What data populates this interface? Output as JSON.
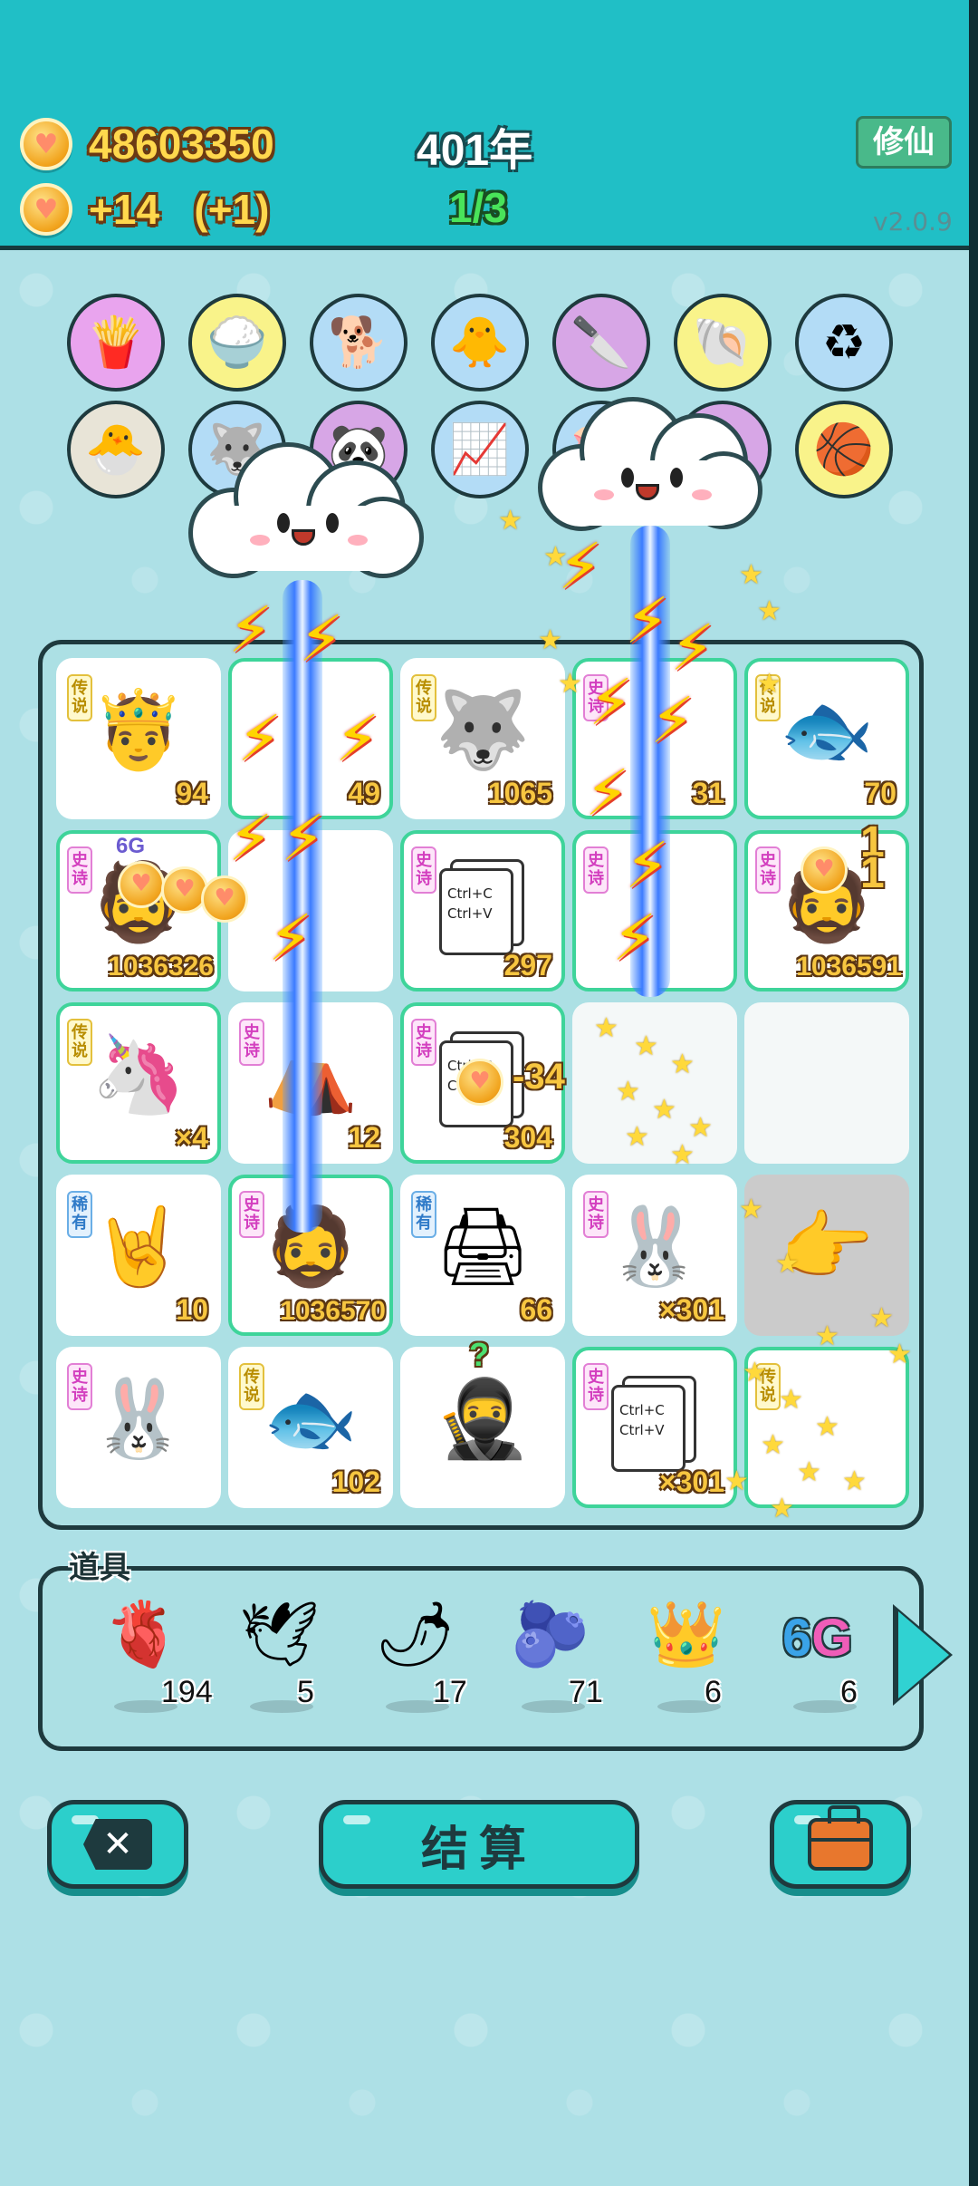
{
  "header": {
    "coins": "48603350",
    "income": "+14   (+1)",
    "year": "401年",
    "wave": "1/3",
    "cultivate_button": "修仙",
    "version": "v2.0.9"
  },
  "creatures": [
    {
      "name": "fries",
      "icon": "🍟",
      "color": "#e9a4ee"
    },
    {
      "name": "rice-bowl",
      "icon": "🍚",
      "color": "#f9f38a"
    },
    {
      "name": "shiba-dog",
      "icon": "🐕",
      "color": "#b3dcf6"
    },
    {
      "name": "chick-egg",
      "icon": "🐥",
      "color": "#b3dcf6"
    },
    {
      "name": "cleaver",
      "icon": "🔪",
      "color": "#d7a6e6"
    },
    {
      "name": "shell",
      "icon": "🐚",
      "color": "#f9f38a"
    },
    {
      "name": "recycle-bag",
      "icon": "♻",
      "color": "#b3dcf6"
    },
    {
      "name": "chick",
      "icon": "🐣",
      "color": "#e8e4d7"
    },
    {
      "name": "husky",
      "icon": "🐺",
      "color": "#b3dcf6"
    },
    {
      "name": "panda",
      "icon": "🐼",
      "color": "#d7a6e6"
    },
    {
      "name": "growth-chart",
      "icon": "📈",
      "color": "#b3dcf6"
    },
    {
      "name": "piggy-bank",
      "icon": "🐷",
      "color": "#b3dcf6"
    },
    {
      "name": "basketballs",
      "icon": "🏀",
      "color": "#f9f38a"
    }
  ],
  "board": {
    "cells": [
      {
        "tag": "传说",
        "tier": "legend",
        "icon": "🤴",
        "count": "94",
        "green": false
      },
      {
        "tag": "",
        "tier": "",
        "icon": "",
        "count": "49",
        "green": true
      },
      {
        "tag": "传说",
        "tier": "legend",
        "icon": "🐺",
        "count": "1065",
        "green": false
      },
      {
        "tag": "史诗",
        "tier": "epic",
        "icon": "",
        "count": "31",
        "green": true
      },
      {
        "tag": "传说",
        "tier": "legend",
        "icon": "🐟",
        "count": "70",
        "green": true
      },
      {
        "tag": "史诗",
        "tier": "epic",
        "icon": "🧔",
        "count": "1036326",
        "green": true
      },
      {
        "tag": "",
        "tier": "",
        "icon": "",
        "count": "",
        "green": false
      },
      {
        "tag": "史诗",
        "tier": "epic",
        "icon": "doc",
        "count": "297",
        "green": true
      },
      {
        "tag": "史诗",
        "tier": "epic",
        "icon": "",
        "count": "",
        "green": true
      },
      {
        "tag": "史诗",
        "tier": "epic",
        "icon": "🧔",
        "count": "1036591",
        "green": true
      },
      {
        "tag": "传说",
        "tier": "legend",
        "icon": "🦄",
        "count": "×4",
        "green": true
      },
      {
        "tag": "史诗",
        "tier": "epic",
        "icon": "⛺",
        "count": "12",
        "green": false
      },
      {
        "tag": "史诗",
        "tier": "epic",
        "icon": "doc",
        "count": "304",
        "green": true
      },
      {
        "tag": "",
        "tier": "",
        "icon": "",
        "count": "",
        "green": false
      },
      {
        "tag": "",
        "tier": "",
        "icon": "",
        "count": "",
        "green": false
      },
      {
        "tag": "稀有",
        "tier": "rare",
        "icon": "🤘",
        "count": "10",
        "green": false
      },
      {
        "tag": "史诗",
        "tier": "epic",
        "icon": "🧔",
        "count": "1036570",
        "green": true
      },
      {
        "tag": "稀有",
        "tier": "rare",
        "icon": "🖨",
        "count": "66",
        "green": false
      },
      {
        "tag": "史诗",
        "tier": "epic",
        "icon": "🐰",
        "count": "×301",
        "green": false
      },
      {
        "tag": "",
        "tier": "",
        "icon": "👉",
        "count": "",
        "green": false
      },
      {
        "tag": "史诗",
        "tier": "epic",
        "icon": "🐰",
        "count": "",
        "green": false
      },
      {
        "tag": "传说",
        "tier": "legend",
        "icon": "🐟",
        "count": "102",
        "green": false
      },
      {
        "tag": "",
        "tier": "",
        "icon": "🥷",
        "count": "",
        "green": false
      },
      {
        "tag": "史诗",
        "tier": "epic",
        "icon": "doc",
        "count": "×301",
        "green": true
      },
      {
        "tag": "传说",
        "tier": "legend",
        "icon": "",
        "count": "",
        "green": true
      }
    ],
    "doc_line1": "Ctrl+C",
    "doc_line2": "Ctrl+V",
    "tag_6g": "6G",
    "float_damage": "-34",
    "float_one": "1",
    "question_mark": "?"
  },
  "items": {
    "label": "道具",
    "list": [
      {
        "name": "liver",
        "icon": "🫀",
        "count": "194"
      },
      {
        "name": "pigeon",
        "icon": "🕊",
        "count": "5"
      },
      {
        "name": "chili-pepper",
        "icon": "🌶",
        "count": "17"
      },
      {
        "name": "blueberry",
        "icon": "🫐",
        "count": "71"
      },
      {
        "name": "crown",
        "icon": "👑",
        "count": "6"
      },
      {
        "name": "6g",
        "icon": "6G",
        "count": "6"
      }
    ]
  },
  "buttons": {
    "settle": "结算"
  }
}
